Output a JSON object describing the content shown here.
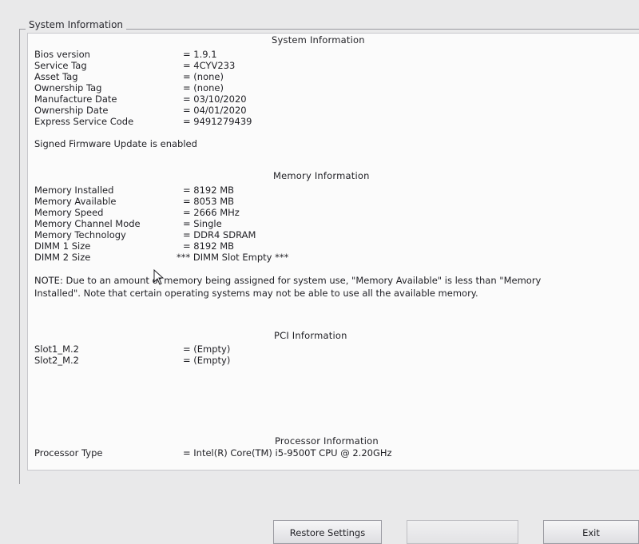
{
  "group_title": "System Information",
  "sections": {
    "system": {
      "heading": "System Information",
      "rows": [
        {
          "label": "Bios version",
          "value": "= 1.9.1"
        },
        {
          "label": "Service Tag",
          "value": "= 4CYV233"
        },
        {
          "label": "Asset Tag",
          "value": "= (none)"
        },
        {
          "label": "Ownership Tag",
          "value": "= (none)"
        },
        {
          "label": "Manufacture Date",
          "value": "= 03/10/2020"
        },
        {
          "label": "Ownership Date",
          "value": "= 04/01/2020"
        },
        {
          "label": "Express Service Code",
          "value": "= 9491279439"
        }
      ],
      "firmware_note": "Signed Firmware Update is enabled"
    },
    "memory": {
      "heading": "Memory Information",
      "rows": [
        {
          "label": "Memory Installed",
          "value": "= 8192 MB"
        },
        {
          "label": "Memory Available",
          "value": "= 8053 MB"
        },
        {
          "label": "Memory Speed",
          "value": "= 2666 MHz"
        },
        {
          "label": "Memory Channel Mode",
          "value": "= Single"
        },
        {
          "label": "Memory Technology",
          "value": "= DDR4 SDRAM"
        },
        {
          "label": "DIMM 1 Size",
          "value": "= 8192 MB"
        },
        {
          "label": "DIMM 2 Size",
          "value": "*** DIMM Slot Empty ***"
        }
      ],
      "note": "NOTE: Due to an amount of memory being assigned for system use, \"Memory Available\" is less than \"Memory Installed\". Note that certain operating systems may not be able to use all the available memory."
    },
    "pci": {
      "heading": "PCI Information",
      "rows": [
        {
          "label": "Slot1_M.2",
          "value": "= (Empty)"
        },
        {
          "label": "Slot2_M.2",
          "value": "= (Empty)"
        }
      ]
    },
    "processor": {
      "heading": "Processor Information",
      "rows": [
        {
          "label": "Processor Type",
          "value": "= Intel(R) Core(TM) i5-9500T CPU @ 2.20GHz"
        }
      ]
    }
  },
  "buttons": {
    "restore": "Restore Settings",
    "middle": "",
    "exit": "Exit"
  }
}
